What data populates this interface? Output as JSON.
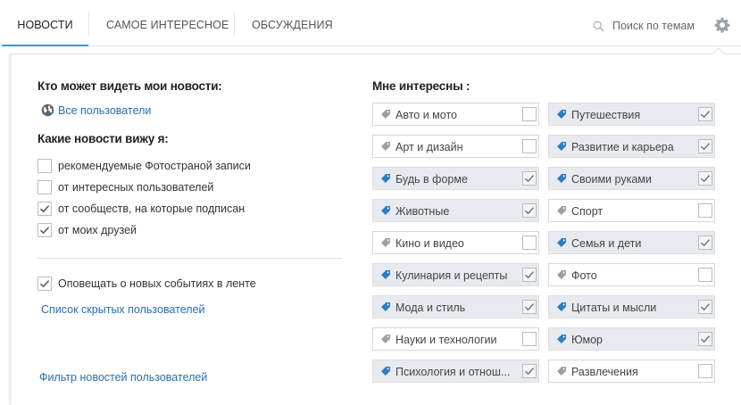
{
  "tabs": [
    {
      "label": "НОВОСТИ",
      "active": true
    },
    {
      "label": "САМОЕ ИНТЕРЕСНОЕ",
      "active": false
    },
    {
      "label": "ОБСУЖДЕНИЯ",
      "active": false
    }
  ],
  "search": {
    "placeholder": "Поиск по темам",
    "icon": "search-icon"
  },
  "settings_icon": "gear-icon",
  "colors": {
    "accent": "#3c94d0",
    "link": "#2a6fb0",
    "tag_on": "#2f7cc0",
    "tag_off": "#9aa0a6",
    "selected_bg": "#e7ebef"
  },
  "left": {
    "who_sees_title": "Кто может видеть мои новости:",
    "who_sees_value": "Все пользователи",
    "which_news_title": "Какие новости вижу я:",
    "options": [
      {
        "label": "рекомендуемые Фотостраной записи",
        "checked": false
      },
      {
        "label": "от интересных пользователей",
        "checked": false
      },
      {
        "label": "от сообществ, на которые подписан",
        "checked": true
      },
      {
        "label": "от моих друзей",
        "checked": true
      }
    ],
    "notify": {
      "label": "Оповещать о новых событиях в ленте",
      "checked": true
    },
    "hidden_users_link": "Список скрытых пользователей",
    "filter_link": "Фильтр новостей пользователей"
  },
  "right": {
    "title": "Мне интересны :",
    "interests": [
      {
        "label": "Авто и мото",
        "checked": false
      },
      {
        "label": "Путешествия",
        "checked": true
      },
      {
        "label": "Арт и дизайн",
        "checked": false
      },
      {
        "label": "Развитие и карьера",
        "checked": true
      },
      {
        "label": "Будь в форме",
        "checked": true
      },
      {
        "label": "Своими руками",
        "checked": true
      },
      {
        "label": "Животные",
        "checked": true
      },
      {
        "label": "Спорт",
        "checked": false
      },
      {
        "label": "Кино и видео",
        "checked": false
      },
      {
        "label": "Семья и дети",
        "checked": true
      },
      {
        "label": "Кулинария и рецепты",
        "checked": true
      },
      {
        "label": "Фото",
        "checked": false
      },
      {
        "label": "Мода и стиль",
        "checked": true
      },
      {
        "label": "Цитаты и мысли",
        "checked": true
      },
      {
        "label": "Науки и технологии",
        "checked": false
      },
      {
        "label": "Юмор",
        "checked": true
      },
      {
        "label": "Психология и отнош...",
        "checked": true
      },
      {
        "label": "Развлечения",
        "checked": false
      }
    ]
  }
}
